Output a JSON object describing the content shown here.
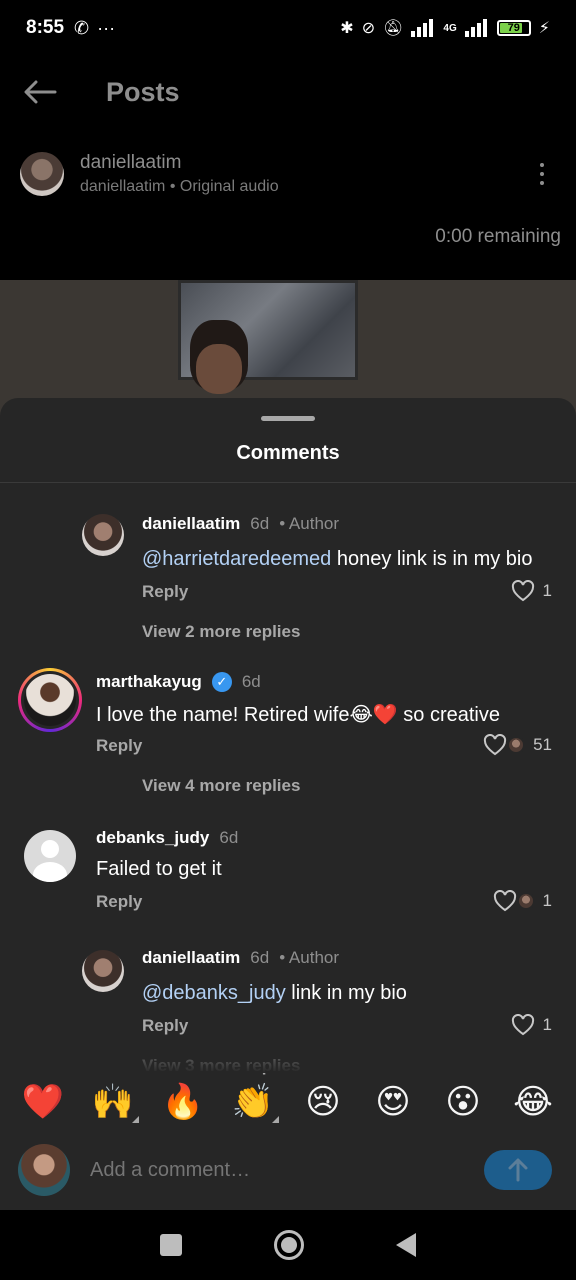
{
  "status_bar": {
    "time": "8:55",
    "battery": "79",
    "network": "4G"
  },
  "header": {
    "title": "Posts"
  },
  "post": {
    "author": "daniellaatim",
    "subtitle": "daniellaatim • Original audio",
    "remaining": "0:00 remaining"
  },
  "sheet": {
    "title": "Comments"
  },
  "comments": [
    {
      "username": "daniellaatim",
      "time": "6d",
      "author_tag": "• Author",
      "mention": "@harrietdaredeemed",
      "text": " honey link is in my bio",
      "reply": "Reply",
      "likes": "1",
      "view_replies": "View 2 more replies"
    },
    {
      "username": "marthakayug",
      "time": "6d",
      "text": "I love the name! Retired wife😂❤️ so creative",
      "reply": "Reply",
      "likes": "51",
      "view_replies": "View 4 more replies"
    },
    {
      "username": "debanks_judy",
      "time": "6d",
      "text": "Failed to get it",
      "reply": "Reply",
      "likes": "1"
    },
    {
      "username": "daniellaatim",
      "time": "6d",
      "author_tag": "• Author",
      "mention": "@debanks_judy",
      "text": " link in my bio",
      "reply": "Reply",
      "likes": "1",
      "view_replies": "View 3 more replies"
    }
  ],
  "emojis": [
    "❤️",
    "🙌",
    "🔥",
    "👏",
    "😢",
    "😍",
    "😮",
    "😂"
  ],
  "composer": {
    "placeholder": "Add a comment…"
  },
  "icons": {
    "back": "back-arrow-icon",
    "more": "more-vertical-icon",
    "heart": "heart-outline-icon",
    "send": "arrow-up-icon"
  },
  "colors": {
    "sheet_bg": "#262626",
    "mention": "#b3d1f5",
    "send_button": "#1d5d8c",
    "verified": "#3897f0"
  }
}
